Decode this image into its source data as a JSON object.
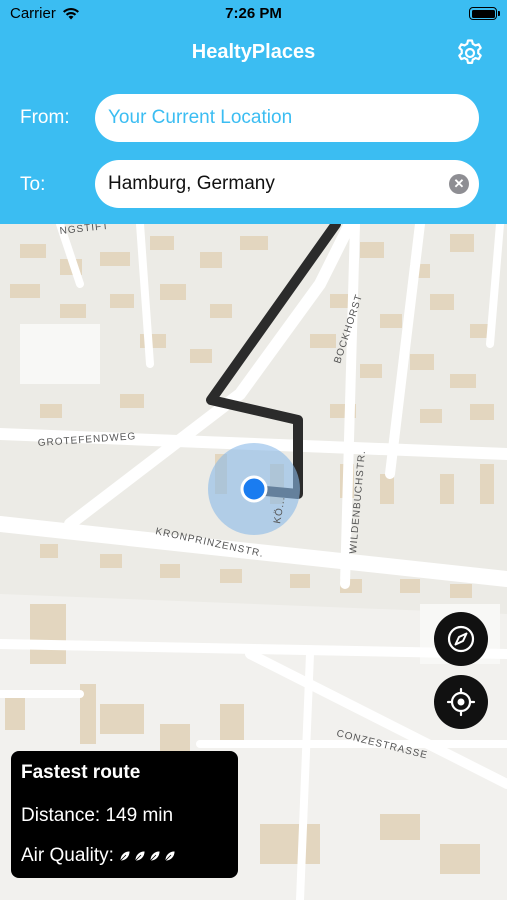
{
  "status_bar": {
    "carrier": "Carrier",
    "time": "7:26 PM"
  },
  "nav": {
    "title": "HealtyPlaces",
    "settings_icon": "gear-icon"
  },
  "search": {
    "from_label": "From:",
    "from_value": "Your Current Location",
    "to_label": "To:",
    "to_value": "Hamburg, Germany"
  },
  "map": {
    "street_labels": [
      "NGSTIFT",
      "BOCKHORST",
      "GROTEFENDWEG",
      "WILDENBUCHSTR.",
      "KRONPRINZENSTR.",
      "KÖ...",
      "CONZESTRASSE"
    ],
    "route_color": "#2b2b2b",
    "location_color": "#1a7cf0"
  },
  "map_controls": {
    "compass_icon": "compass-icon",
    "locate_icon": "crosshair-icon"
  },
  "route_card": {
    "title": "Fastest route",
    "distance": "Distance: 149 min",
    "air_quality_label": "Air Quality:",
    "air_quality_leaves": 4
  },
  "colors": {
    "accent": "#3bbdf2"
  }
}
